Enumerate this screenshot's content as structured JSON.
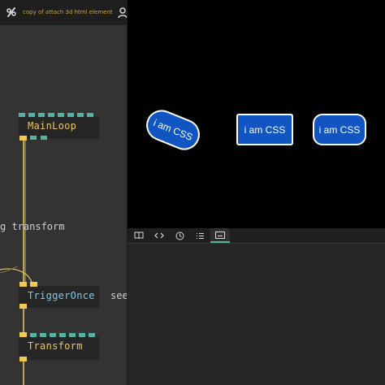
{
  "editor": {
    "title": "copy of attach 3d html element",
    "nodes": [
      {
        "label": "MainLoop",
        "color": "#e8c66a"
      },
      {
        "label": "TriggerOnce",
        "color": "#7ec8e8"
      },
      {
        "label": "Transform",
        "color": "#e8c66a"
      }
    ],
    "side_texts": [
      "g transform",
      "see"
    ],
    "colors": {
      "port_teal": "#55b3a1",
      "port_yellow": "#f0c954",
      "cable": "#e8c66a"
    }
  },
  "canvas": {
    "boxes": [
      {
        "label": "i am CSS"
      },
      {
        "label": "i am CSS"
      },
      {
        "label": "i am CSS"
      }
    ],
    "box_color": "#1155c2"
  },
  "bottom_panel": {
    "tabs": [
      {
        "icon": "book-icon"
      },
      {
        "icon": "code-icon"
      },
      {
        "icon": "clock-icon"
      },
      {
        "icon": "list-icon"
      },
      {
        "icon": "console-icon",
        "active": true
      }
    ]
  }
}
